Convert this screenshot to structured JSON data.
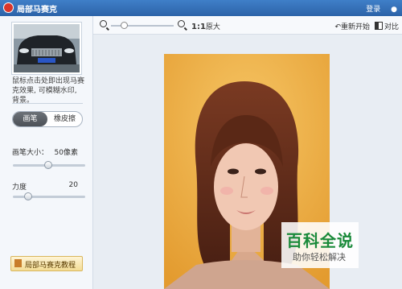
{
  "title": "局部马赛克",
  "title_right": {
    "login": "登录",
    "extra": "●"
  },
  "sidebar": {
    "hint": "鼠标点击处即出现马赛克效果, 可模糊水印, 背景。",
    "tabs": [
      "画笔",
      "橡皮擦"
    ],
    "brush_size_label": "画笔大小：",
    "brush_size_value": "50像素",
    "strength_label": "力度",
    "strength_value": "20",
    "tutorial_label": "局部马赛克教程"
  },
  "toolbar": {
    "ratio_bold": "1:1",
    "ratio_label": "原大",
    "reset_label": "重新开始",
    "compare_label": "对比"
  },
  "watermark": {
    "big": "百科全说",
    "small": "助你轻松解决"
  },
  "colors": {
    "title_bar": "#2c63a8",
    "watermark_green": "#1a8a3a",
    "photo_bg": "#f0b848"
  }
}
